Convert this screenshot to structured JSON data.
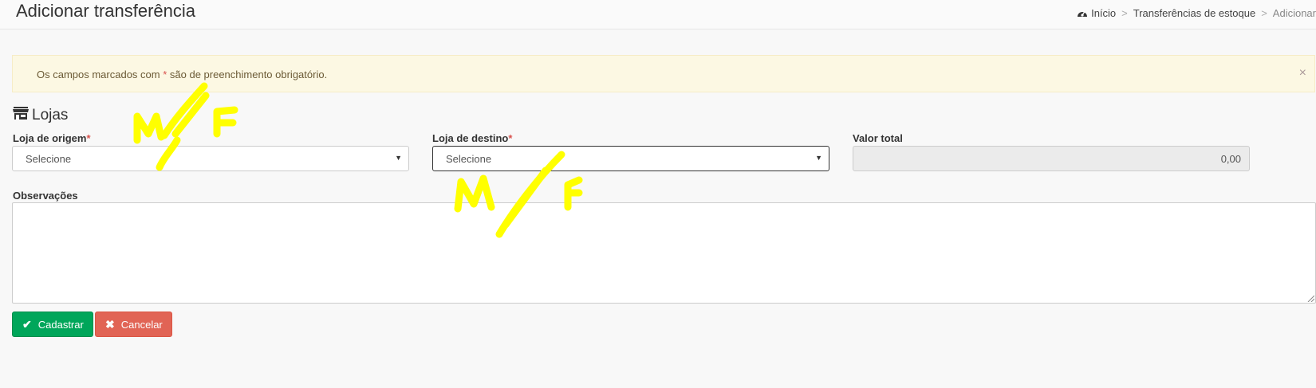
{
  "header": {
    "title": "Adicionar transferência",
    "breadcrumb": {
      "home": "Início",
      "section": "Transferências de estoque",
      "current": "Adicionar"
    }
  },
  "alert": {
    "text_before": "Os campos marcados com ",
    "required_mark": "*",
    "text_after": " são de preenchimento obrigatório.",
    "close": "×"
  },
  "section": {
    "title": "Lojas",
    "icon": "store-icon"
  },
  "form": {
    "origin": {
      "label": "Loja de origem",
      "required": "*",
      "value": "Selecione"
    },
    "destination": {
      "label": "Loja de destino",
      "required": "*",
      "value": "Selecione"
    },
    "total": {
      "label": "Valor total",
      "value": "0,00"
    },
    "notes": {
      "label": "Observações",
      "value": ""
    }
  },
  "buttons": {
    "save": {
      "label": "Cadastrar",
      "icon": "check-icon",
      "color": "#00a65a"
    },
    "cancel": {
      "label": "Cancelar",
      "icon": "times-icon",
      "color": "#dd4b39"
    }
  },
  "colors": {
    "alert_bg": "#fcf8e3",
    "required": "#d9534f",
    "annotation": "#ffff00"
  }
}
